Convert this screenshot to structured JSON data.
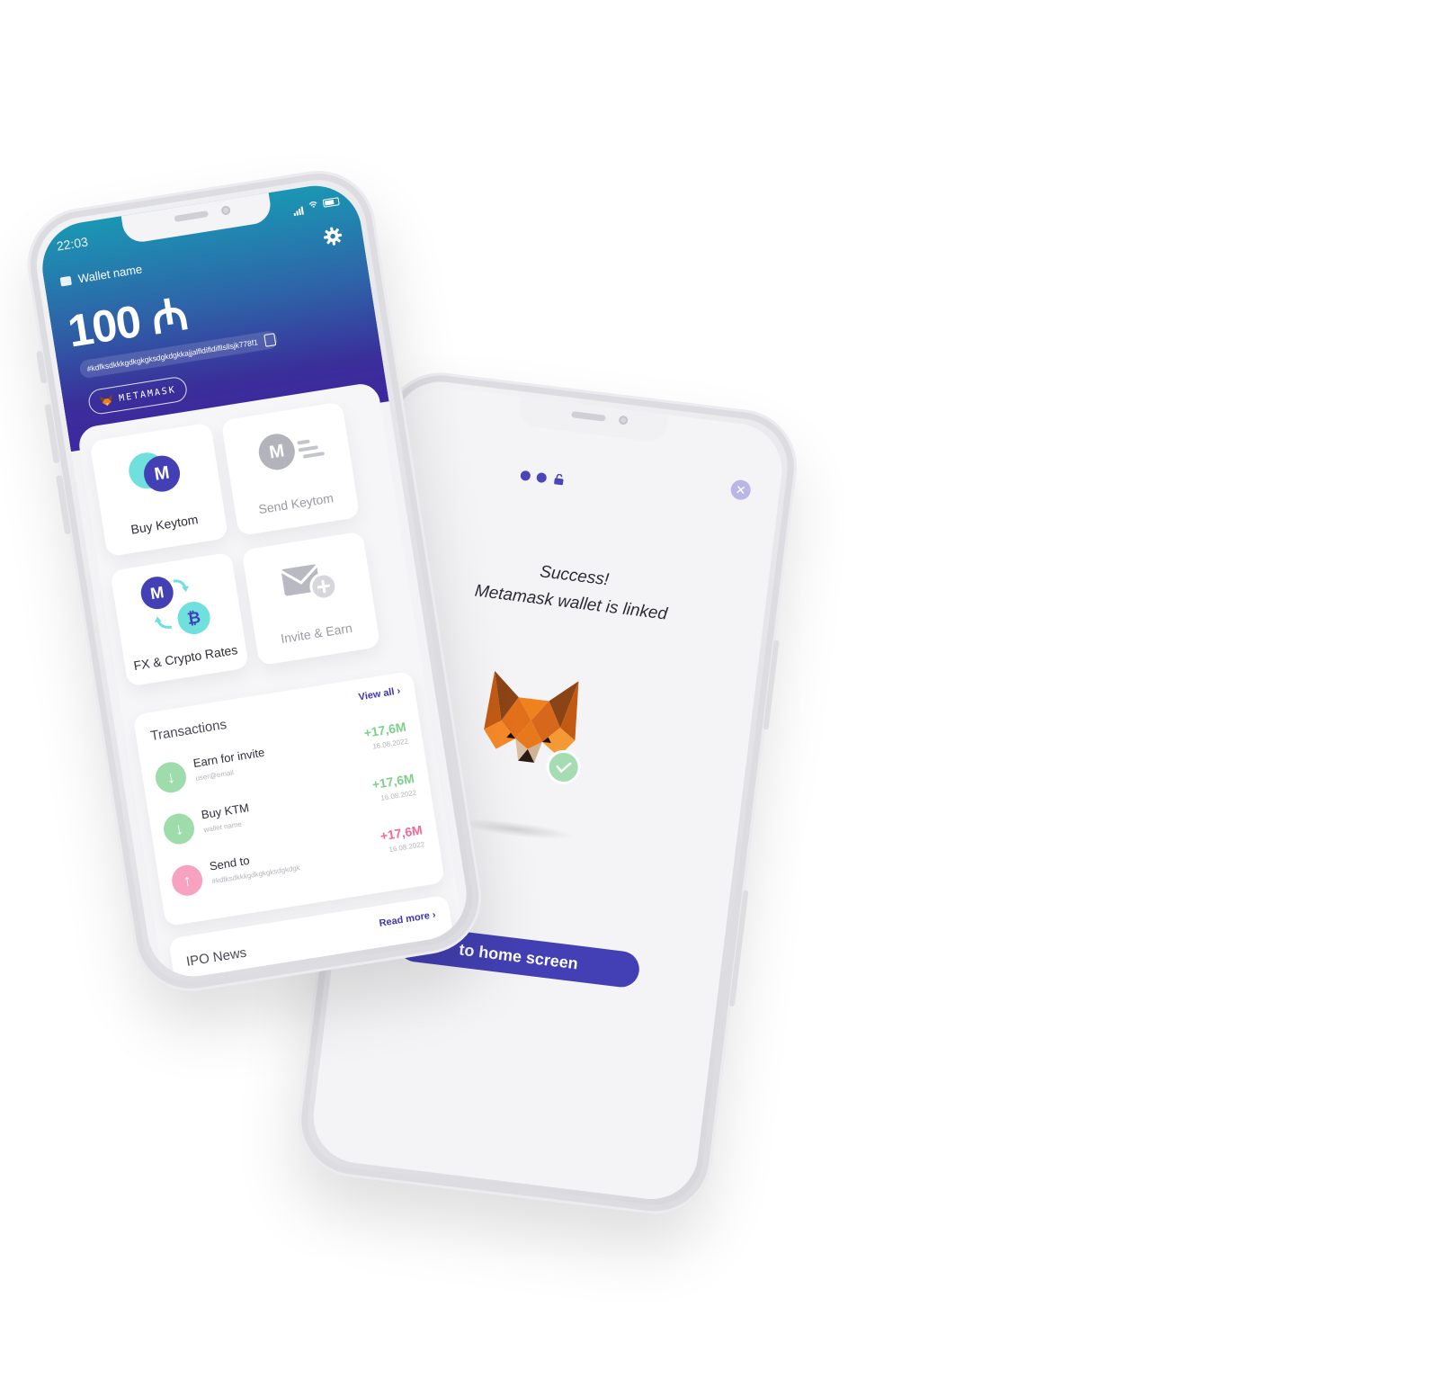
{
  "success_screen": {
    "success_title": "Success!",
    "success_message": "Metamask wallet is linked",
    "close_symbol": "✕",
    "home_button_label": "to home screen",
    "icons": [
      "dots-lock-icon",
      "close-icon",
      "metamask-fox-icon",
      "check-icon"
    ]
  },
  "wallet_screen": {
    "status_time": "22:03",
    "wallet_name": "Wallet name",
    "balance": "100 ₼",
    "address": "#kdfksdkkkgdkgkgksdgkdgkkajjalfldifldifllsllsjk778f1",
    "metamask_label": "METAMASK",
    "actions": [
      {
        "label": "Buy Keytom",
        "coin_letter": "M"
      },
      {
        "label": "Send Keytom",
        "coin_letter": "M"
      },
      {
        "label": "FX & Crypto Rates",
        "coin_letter": "M",
        "coin_letter_2": "₿"
      },
      {
        "label": "Invite & Earn"
      }
    ],
    "transactions": {
      "title": "Transactions",
      "view_all": "View all ›",
      "items": [
        {
          "name": "Earn for invite",
          "sub": "user@email",
          "amount": "+17,6M",
          "date": "16.08.2022",
          "direction": "down"
        },
        {
          "name": "Buy KTM",
          "sub": "wallet name",
          "amount": "+17,6M",
          "date": "16.08.2022",
          "direction": "down"
        },
        {
          "name": "Send to",
          "sub": "#kdfksdkkkgdkgkgksdgkdgk",
          "amount": "+17,6M",
          "date": "16.08.2022",
          "direction": "up"
        }
      ]
    },
    "news": {
      "title": "IPO News",
      "read_more": "Read more ›"
    }
  },
  "colors": {
    "brand_purple": "#4340b5",
    "header_teal": "#1a97b4",
    "header_violet": "#3f27a0",
    "positive_green": "#7fcf8c",
    "negative_pink": "#f06a9a"
  }
}
